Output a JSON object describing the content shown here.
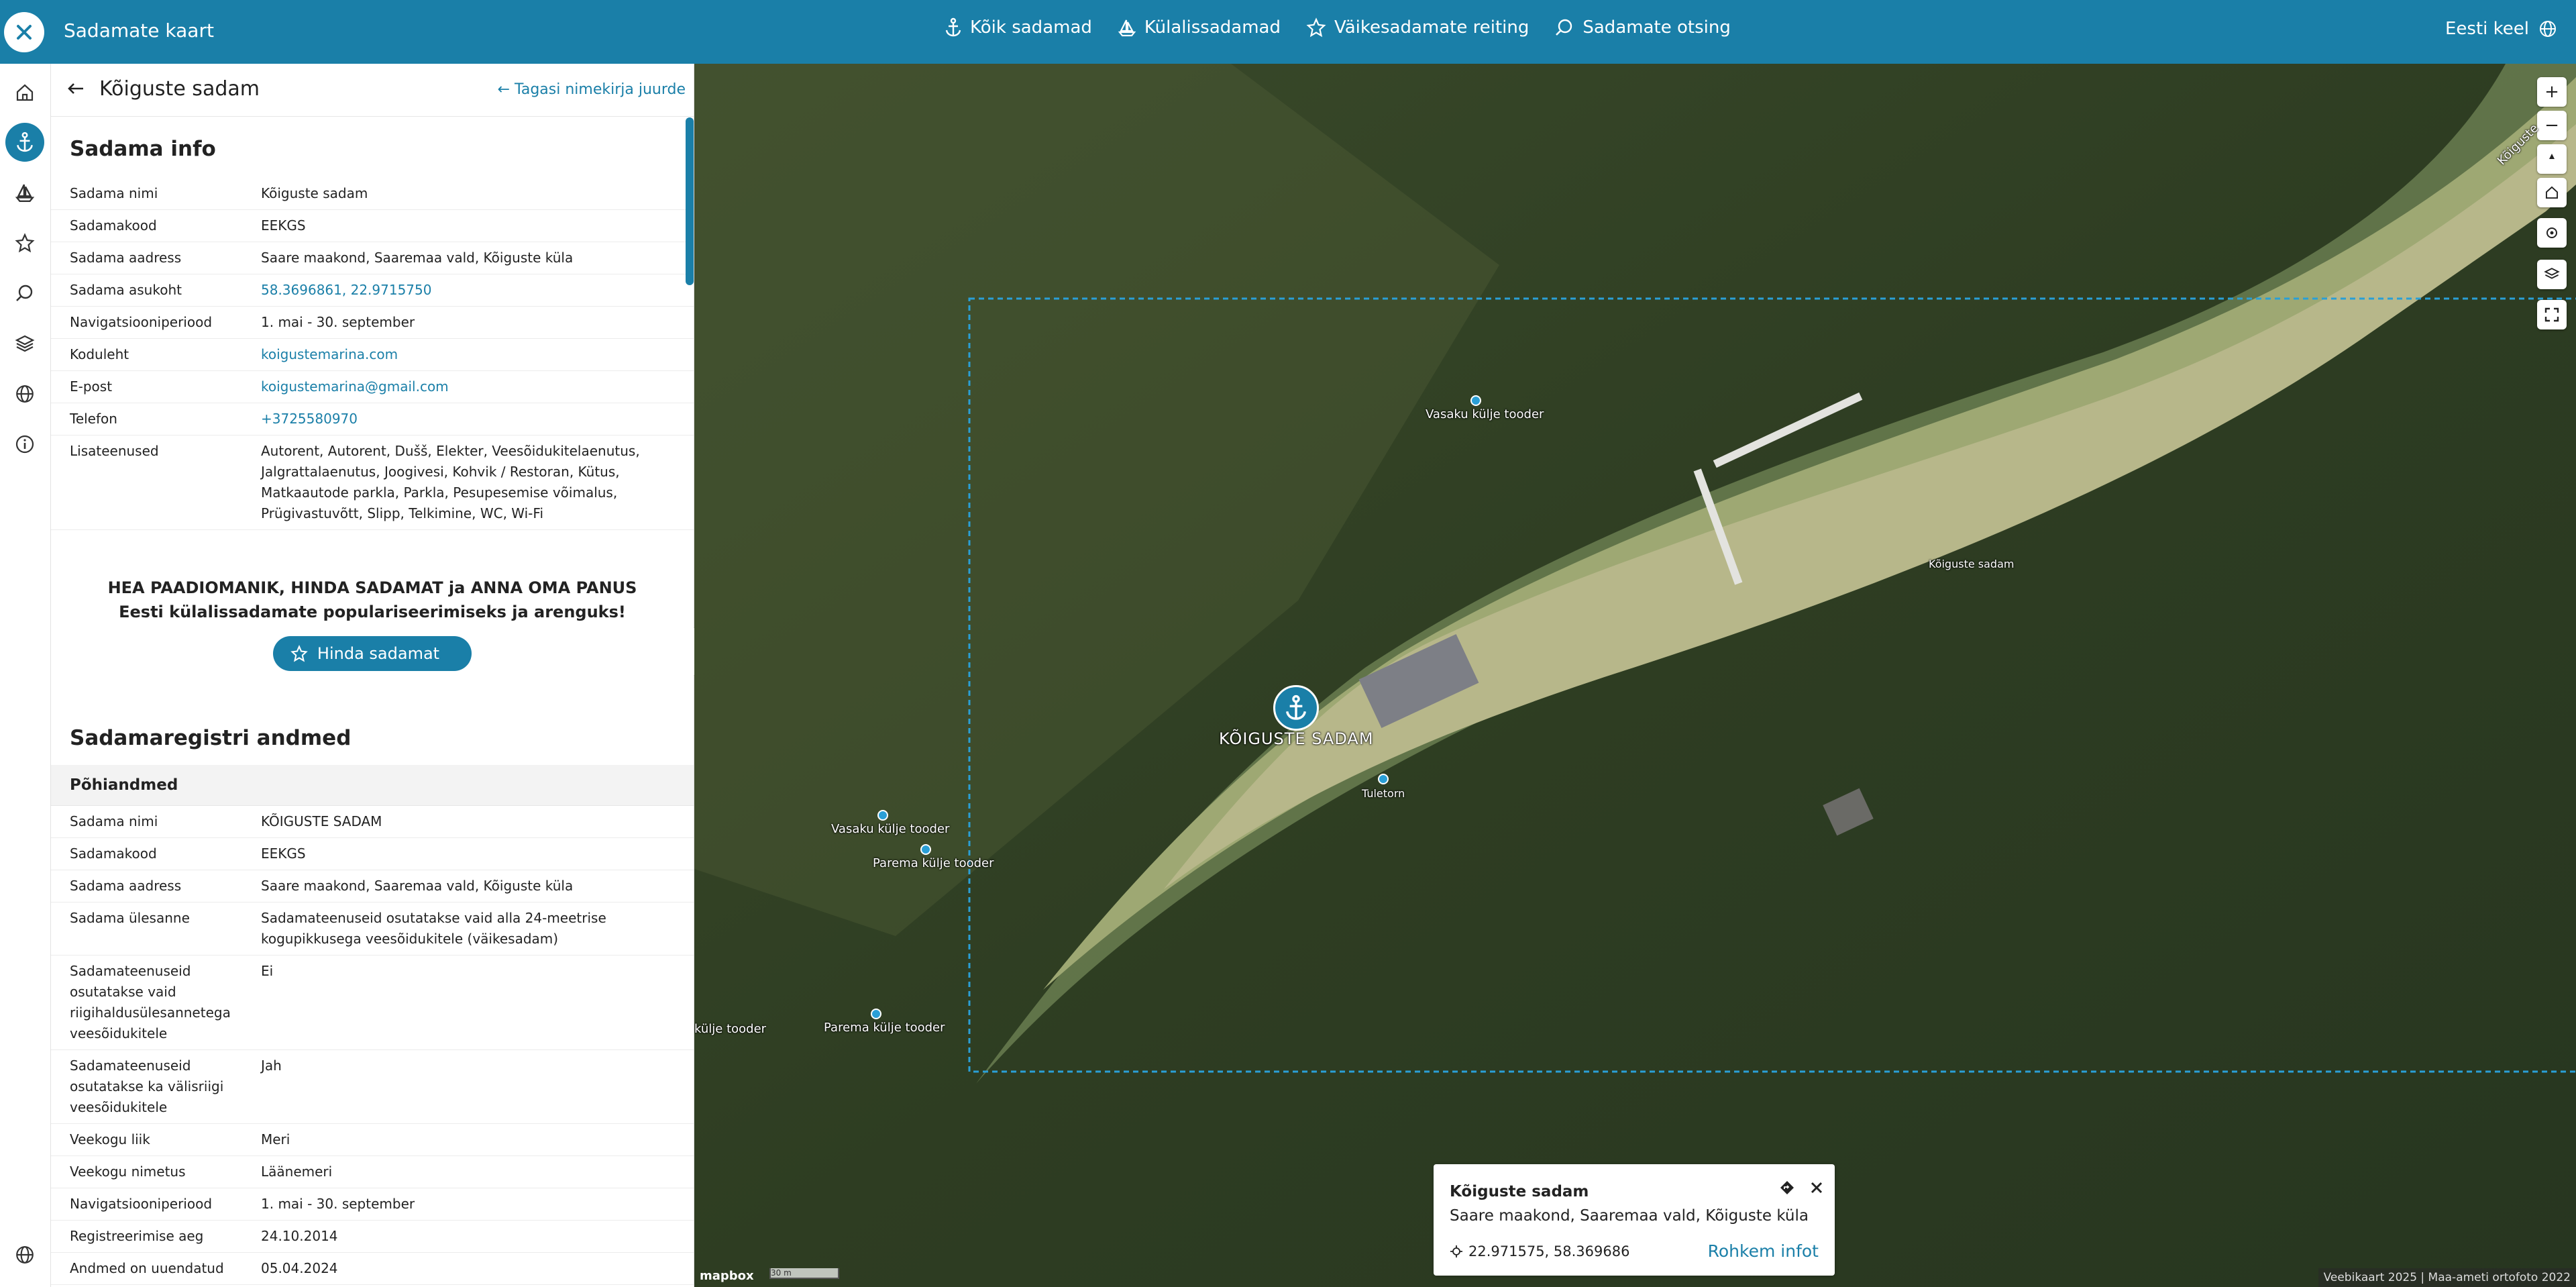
{
  "app": {
    "title": "Sadamate kaart",
    "language": "Eesti keel"
  },
  "nav": [
    {
      "label": "Kõik sadamad",
      "icon": "anchor-icon"
    },
    {
      "label": "Külalissadamad",
      "icon": "sailboat-icon"
    },
    {
      "label": "Väikesadamate reiting",
      "icon": "star-icon"
    },
    {
      "label": "Sadamate otsing",
      "icon": "search-icon"
    }
  ],
  "rail": [
    "home-icon",
    "anchor-icon",
    "sailboat-icon",
    "star-icon",
    "search-icon",
    "layers-icon",
    "globe-icon",
    "info-icon",
    "footer-globe-icon"
  ],
  "panel": {
    "title": "Kõiguste sadam",
    "back_to_list": "← Tagasi nimekirja juurde",
    "info_title": "Sadama info",
    "info": [
      {
        "k": "Sadama nimi",
        "v": "Kõiguste sadam"
      },
      {
        "k": "Sadamakood",
        "v": "EEKGS"
      },
      {
        "k": "Sadama aadress",
        "v": "Saare maakond, Saaremaa vald, Kõiguste küla"
      },
      {
        "k": "Sadama asukoht",
        "v": "58.3696861, 22.9715750",
        "link": true
      },
      {
        "k": "Navigatsiooniperiood",
        "v": "1. mai - 30. september"
      },
      {
        "k": "Koduleht",
        "v": "koigustemarina.com",
        "link": true
      },
      {
        "k": "E-post",
        "v": "koigustemarina@gmail.com",
        "link": true
      },
      {
        "k": "Telefon",
        "v": "+3725580970",
        "link": true
      },
      {
        "k": "Lisateenused",
        "v": "Autorent, Autorent, Dušš, Elekter, Veesõidukitelaenutus, Jalgrattalaenutus, Joogivesi, Kohvik / Restoran, Kütus, Matkaautode parkla, Parkla, Pesupesemise võimalus, Prügivastuvõtt, Slipp, Telkimine, WC, Wi-Fi"
      }
    ],
    "promo_line1": "HEA PAADIOMANIK, HINDA SADAMAT ja ANNA OMA PANUS",
    "promo_line2": "Eesti külalissadamate populariseerimiseks ja arenguks!",
    "rate_button": "Hinda sadamat",
    "registry_title": "Sadamaregistri andmed",
    "registry_sub": "Põhiandmed",
    "registry": [
      {
        "k": "Sadama nimi",
        "v": "KÕIGUSTE SADAM"
      },
      {
        "k": "Sadamakood",
        "v": "EEKGS"
      },
      {
        "k": "Sadama aadress",
        "v": "Saare maakond, Saaremaa vald, Kõiguste küla"
      },
      {
        "k": "Sadama ülesanne",
        "v": "Sadamateenuseid osutatakse vaid alla 24-meetrise kogupikkusega veesõidukitele (väikesadam)"
      },
      {
        "k": "Sadamateenuseid osutatakse vaid riigihaldusülesannetega veesõidukitele",
        "v": "Ei"
      },
      {
        "k": "Sadamateenuseid osutatakse ka välisriigi veesõidukitele",
        "v": "Jah"
      },
      {
        "k": "Veekogu liik",
        "v": "Meri"
      },
      {
        "k": "Veekogu nimetus",
        "v": "Läänemeri"
      },
      {
        "k": "Navigatsiooniperiood",
        "v": "1. mai - 30. september"
      },
      {
        "k": "Registreerimise aeg",
        "v": "24.10.2014"
      },
      {
        "k": "Andmed on uuendatud",
        "v": "05.04.2024"
      }
    ]
  },
  "map": {
    "harbor_label": "KÕIGUSTE SADAM",
    "labels": [
      {
        "text": "Vasaku külje tooder"
      },
      {
        "text": "Vasaku külje tooder"
      },
      {
        "text": "Parema külje tooder"
      },
      {
        "text": "Parema külje tooder"
      },
      {
        "text": "külje tooder"
      },
      {
        "text": "Kõiguste sadam"
      },
      {
        "text": "Tuletorn"
      }
    ],
    "popup": {
      "title": "Kõiguste sadam",
      "address": "Saare maakond, Saaremaa vald, Kõiguste küla",
      "coords": "22.971575, 58.369686",
      "more": "Rohkem infot"
    },
    "attribution": "Veebikaart 2025 | Maa-ameti ortofoto 2022",
    "logo": "mapbox",
    "scale": "30 m",
    "road_label": "Kõiguste"
  },
  "colors": {
    "accent": "#1a7fa8"
  }
}
